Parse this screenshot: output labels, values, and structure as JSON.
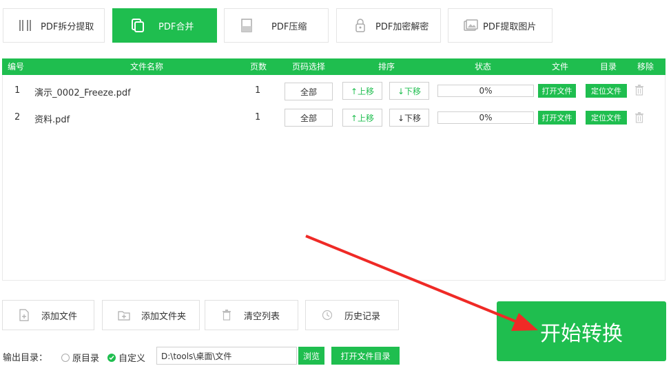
{
  "tabs": [
    {
      "label": "PDF拆分提取",
      "icon": "split-icon"
    },
    {
      "label": "PDF合并",
      "icon": "merge-icon",
      "active": true
    },
    {
      "label": "PDF压缩",
      "icon": "compress-icon"
    },
    {
      "label": "PDF加密解密",
      "icon": "lock-icon"
    },
    {
      "label": "PDF提取图片",
      "icon": "image-icon"
    }
  ],
  "table": {
    "headers": {
      "num": "编号",
      "name": "文件名称",
      "pages": "页数",
      "page_select": "页码选择",
      "sort": "排序",
      "status": "状态",
      "file": "文件",
      "dir": "目录",
      "remove": "移除"
    },
    "rows": [
      {
        "num": "1",
        "name": "演示_0002_Freeze.pdf",
        "pages": "1",
        "page_select": "全部",
        "up": "↑上移",
        "down": "↓下移",
        "progress": 0,
        "status": "0%",
        "open": "打开文件",
        "locate": "定位文件"
      },
      {
        "num": "2",
        "name": "资料.pdf",
        "pages": "1",
        "page_select": "全部",
        "up": "↑上移",
        "down": "↓下移",
        "progress": 0,
        "status": "0%",
        "open": "打开文件",
        "locate": "定位文件"
      }
    ]
  },
  "bottom_buttons": {
    "add_file": "添加文件",
    "add_folder": "添加文件夹",
    "clear_list": "清空列表",
    "history": "历史记录"
  },
  "output": {
    "label": "输出目录：",
    "radio_original": "原目录",
    "radio_custom": "自定义",
    "path": "D:\\tools\\桌面\\文件",
    "browse": "浏览",
    "open_dir": "打开文件目录"
  },
  "start_button": "开始转换",
  "colors": {
    "accent": "#1fbe4f",
    "arrow": "#ef2a26"
  }
}
